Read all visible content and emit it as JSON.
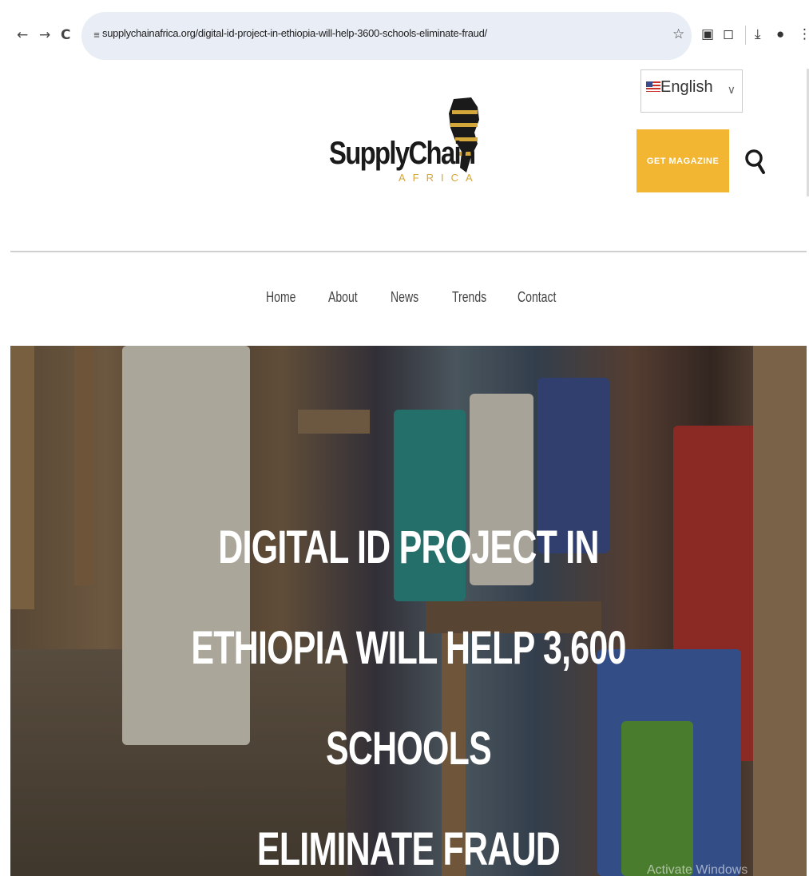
{
  "browser": {
    "url": "supplychainafrica.org/digital-id-project-in-ethiopia-will-help-3600-schools-eliminate-fraud/",
    "back_icon": "←",
    "forward_icon": "→",
    "reload_icon": "C",
    "site_info_icon": "≡",
    "star_icon": "☆",
    "ext_icon": "▣",
    "puzzle_icon": "◻",
    "download_icon": "⤓",
    "profile_icon": "●",
    "menu_icon": "⋮"
  },
  "header": {
    "language": "English",
    "language_caret": "∨",
    "logo_main": "SupplyChain",
    "logo_sub": "AFRICA",
    "magazine_button": "GET MAGAZINE"
  },
  "nav": {
    "items": [
      "Home",
      "About",
      "News",
      "Trends",
      "Contact"
    ]
  },
  "hero": {
    "title_line1": "DIGITAL ID PROJECT IN ETHIOPIA WILL HELP 3,600 SCHOOLS",
    "title_line2": "ELIMINATE FRAUD",
    "watermark": "Activate Windows"
  },
  "colors": {
    "accent": "#f2b632",
    "omnibox": "#e9edf5"
  }
}
